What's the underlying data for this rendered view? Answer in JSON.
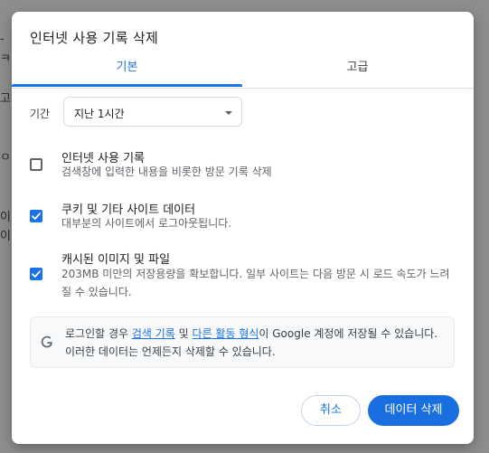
{
  "background": {
    "glyphs": [
      "-",
      "ㅋ",
      "고",
      "ㅇ",
      "이",
      "이"
    ]
  },
  "dialog": {
    "title": "인터넷 사용 기록 삭제",
    "tabs": [
      {
        "label": "기본",
        "active": true
      },
      {
        "label": "고급",
        "active": false
      }
    ],
    "time_range": {
      "label": "기간",
      "value": "지난 1시간"
    },
    "options": [
      {
        "title": "인터넷 사용 기록",
        "desc": "검색창에 입력한 내용을 비롯한 방문 기록 삭제",
        "checked": false
      },
      {
        "title": "쿠키 및 기타 사이트 데이터",
        "desc": "대부분의 사이트에서 로그아웃됩니다.",
        "checked": true
      },
      {
        "title": "캐시된 이미지 및 파일",
        "desc": "203MB 미만의 저장용량을 확보합니다. 일부 사이트는 다음 방문 시 로드 속도가 느려질 수 있습니다.",
        "checked": true
      }
    ],
    "info": {
      "part1": "로그인할 경우 ",
      "link1": "검색 기록",
      "part2": " 및 ",
      "link2": "다른 활동 형식",
      "part3": "이 Google 계정에 저장될 수 있습니다. 이러한 데이터는 언제든지 삭제할 수 있습니다."
    },
    "buttons": {
      "cancel": "취소",
      "delete": "데이터 삭제"
    }
  },
  "colors": {
    "accent": "#1a73e8",
    "checkbox_checked": "#1a73e8",
    "primary_button": "#1a6fe0"
  },
  "icons": {
    "logo": "google-g-icon",
    "checkmark": "checkmark-icon",
    "dropdown": "caret-down-icon"
  }
}
